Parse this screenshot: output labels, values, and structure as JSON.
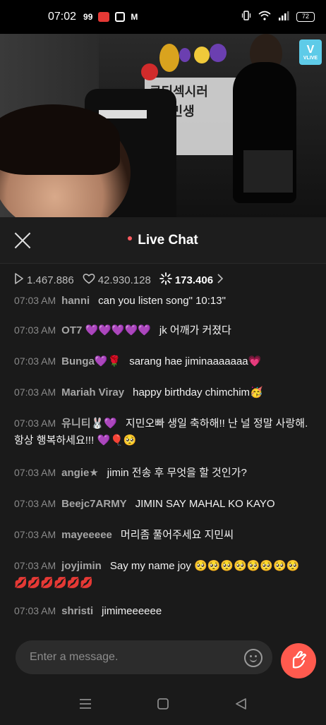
{
  "status_bar": {
    "time": "07:02",
    "icon_99": "99",
    "battery": "72"
  },
  "video": {
    "banner_line1": "큐티섹시러",
    "banner_line2": "지민생",
    "badge_text": "VLIVE"
  },
  "chat": {
    "title": "Live Chat",
    "stats": {
      "plays": "1.467.886",
      "hearts": "42.930.128",
      "viewers": "173.406"
    },
    "messages": [
      {
        "time": "07:03 AM",
        "user": "hanni",
        "text": "can you listen song\" 10:13\""
      },
      {
        "time": "07:03 AM",
        "user": "OT7 💜💜💜💜💜",
        "text": "jk 어깨가 커졌다"
      },
      {
        "time": "07:03 AM",
        "user": "Bunga💜🌹",
        "text": "sarang hae jiminaaaaaaa💗"
      },
      {
        "time": "07:03 AM",
        "user": "Mariah Viray",
        "text": "happy birthday chimchim🥳"
      },
      {
        "time": "07:03 AM",
        "user": "유니티🐰💜",
        "text": "지민오빠 생일 축하해!! 난 널 정말 사랑해. 항상 행복하세요!!! 💜🎈🥺"
      },
      {
        "time": "07:03 AM",
        "user": "angie★",
        "text": "jimin 전송 후 무엇을 할 것인가?"
      },
      {
        "time": "07:03 AM",
        "user": "Beejc7ARMY",
        "text": "JIMIN SAY MAHAL KO KAYO"
      },
      {
        "time": "07:03 AM",
        "user": "mayeeeee",
        "text": "머리좀 풀어주세요 지민씨"
      },
      {
        "time": "07:03 AM",
        "user": "joyjimin",
        "text": "Say my name joy 🥺🥺🥺🥺🥺🥺🥺🥺💋💋💋💋💋💋"
      },
      {
        "time": "07:03 AM",
        "user": "shristi",
        "text": "jimimeeeeee"
      }
    ],
    "input_placeholder": "Enter a message."
  },
  "colors": {
    "accent": "#ff5a4e",
    "live_dot": "#ff5a5f",
    "vlive_badge": "#5ecbe8"
  },
  "icons": [
    "close-icon",
    "play-icon",
    "heart-icon",
    "sparkle-icon",
    "chevron-right-icon",
    "emoji-icon",
    "finger-heart-icon",
    "menu-icon",
    "home-icon",
    "back-icon"
  ]
}
